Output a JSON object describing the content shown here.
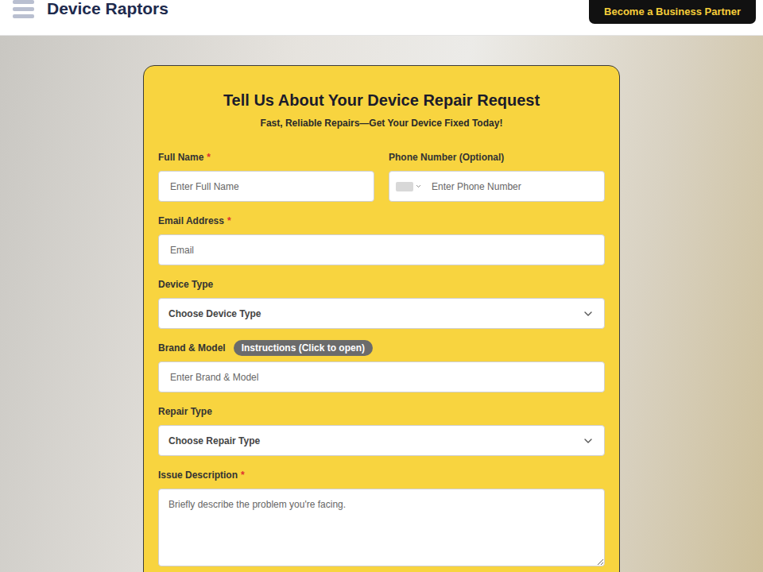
{
  "header": {
    "logo": "Device Raptors",
    "partner_button": "Become a Business Partner"
  },
  "form": {
    "title": "Tell Us About Your Device Repair Request",
    "subtitle": "Fast, Reliable Repairs—Get Your Device Fixed Today!",
    "required_mark": "*",
    "rows": [
      [
        {
          "kind": "text",
          "label": "Full Name",
          "required": true,
          "placeholder": "Enter Full Name"
        },
        {
          "kind": "phone",
          "label": "Phone Number (Optional)",
          "required": false,
          "placeholder": "Enter Phone Number"
        }
      ],
      [
        {
          "kind": "text",
          "label": "Email Address",
          "required": true,
          "placeholder": "Email"
        }
      ],
      [
        {
          "kind": "select",
          "label": "Device Type",
          "required": false,
          "placeholder": "Choose Device Type"
        }
      ],
      [
        {
          "kind": "text",
          "label": "Brand & Model",
          "required": false,
          "placeholder": "Enter Brand & Model",
          "badge": "Instructions (Click to open)"
        }
      ],
      [
        {
          "kind": "select",
          "label": "Repair Type",
          "required": false,
          "placeholder": "Choose Repair Type"
        }
      ],
      [
        {
          "kind": "textarea",
          "label": "Issue Description",
          "required": true,
          "placeholder": "Briefly describe the problem you're facing."
        }
      ]
    ]
  }
}
